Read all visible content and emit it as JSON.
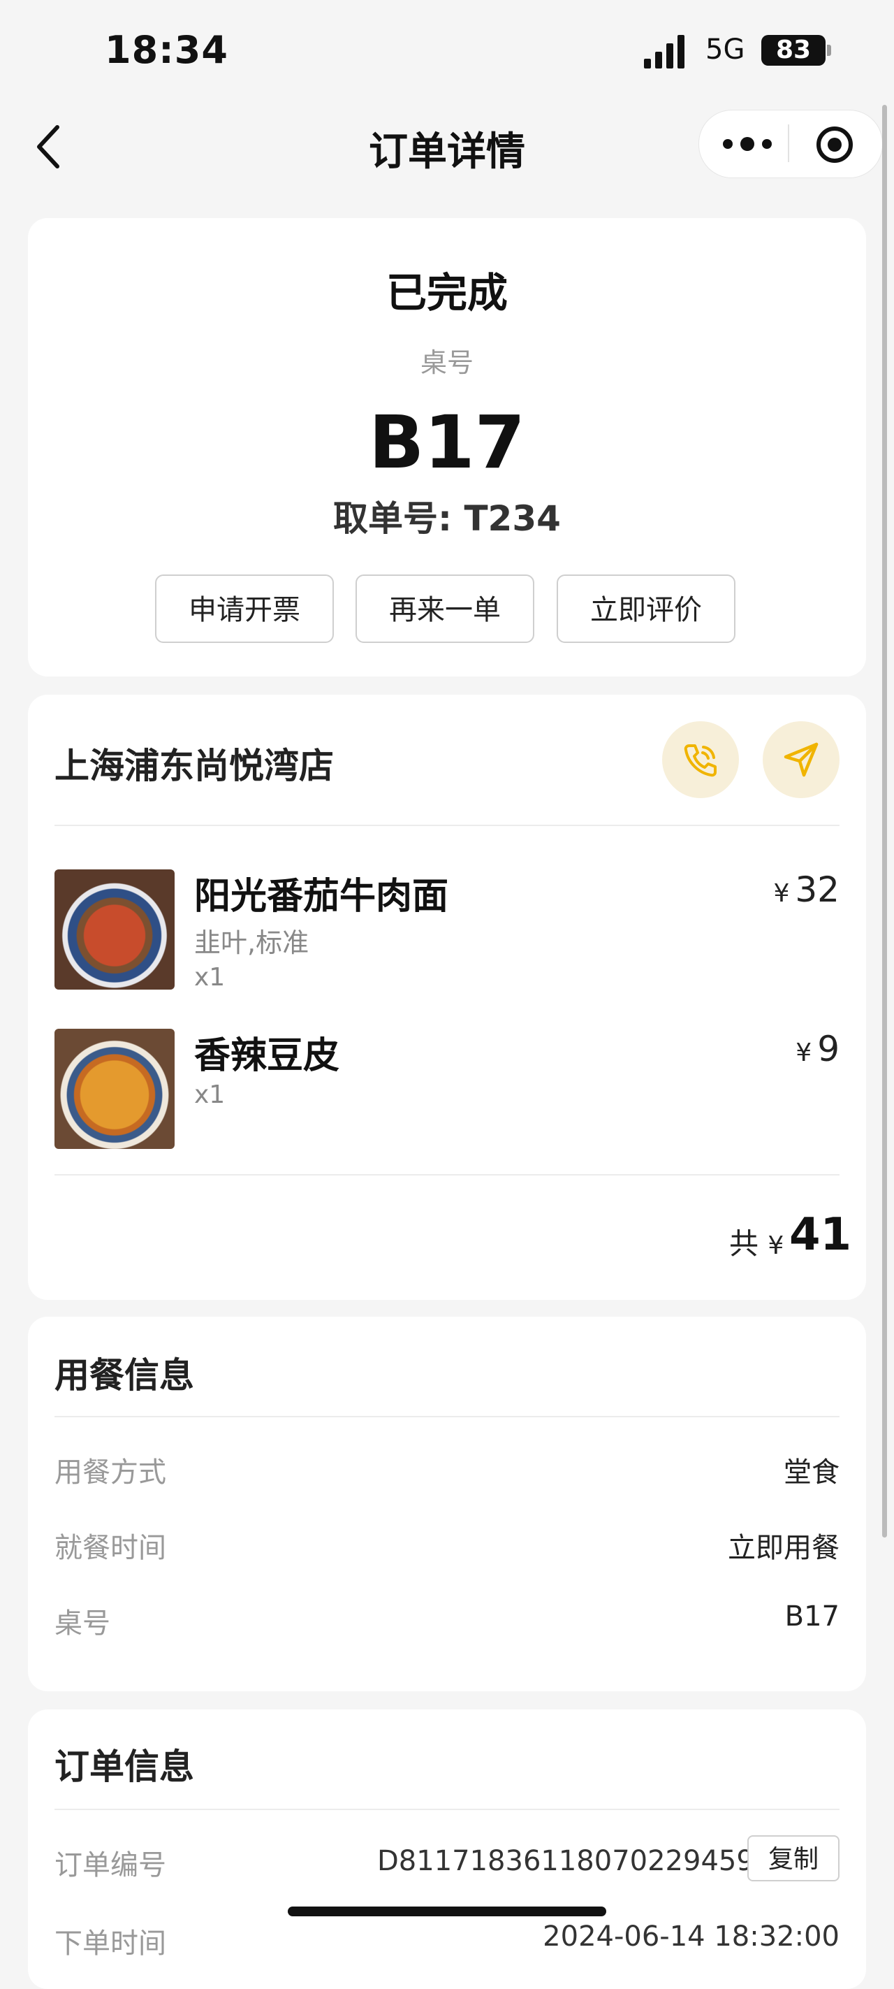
{
  "status_bar": {
    "time": "18:34",
    "network": "5G",
    "battery": "83"
  },
  "nav": {
    "title": "订单详情"
  },
  "order": {
    "status": "已完成",
    "table_label": "桌号",
    "table_number": "B17",
    "pickup": "取单号: T234",
    "actions": [
      "申请开票",
      "再来一单",
      "立即评价"
    ]
  },
  "store": {
    "name": "上海浦东尚悦湾店",
    "items": [
      {
        "name": "阳光番茄牛肉面",
        "spec": "韭叶,标准",
        "qty": "x1",
        "currency": "¥",
        "price": "32"
      },
      {
        "name": "香辣豆皮",
        "qty": "x1",
        "currency": "¥",
        "price": "9"
      }
    ],
    "total_prefix": "共",
    "total_currency": "¥",
    "total": "41"
  },
  "dining_info": {
    "title": "用餐信息",
    "rows": [
      {
        "label": "用餐方式",
        "value": "堂食"
      },
      {
        "label": "就餐时间",
        "value": "立即用餐"
      },
      {
        "label": "桌号",
        "value": "B17"
      }
    ]
  },
  "order_info": {
    "title": "订单信息",
    "order_no_label": "订单编号",
    "order_no": "D81171836118070229459",
    "copy_label": "复制",
    "time_label": "下单时间",
    "time_value": "2024-06-14 18:32:00"
  },
  "colors": {
    "accent": "#f0b400",
    "accent_bg": "#f7efd9"
  }
}
